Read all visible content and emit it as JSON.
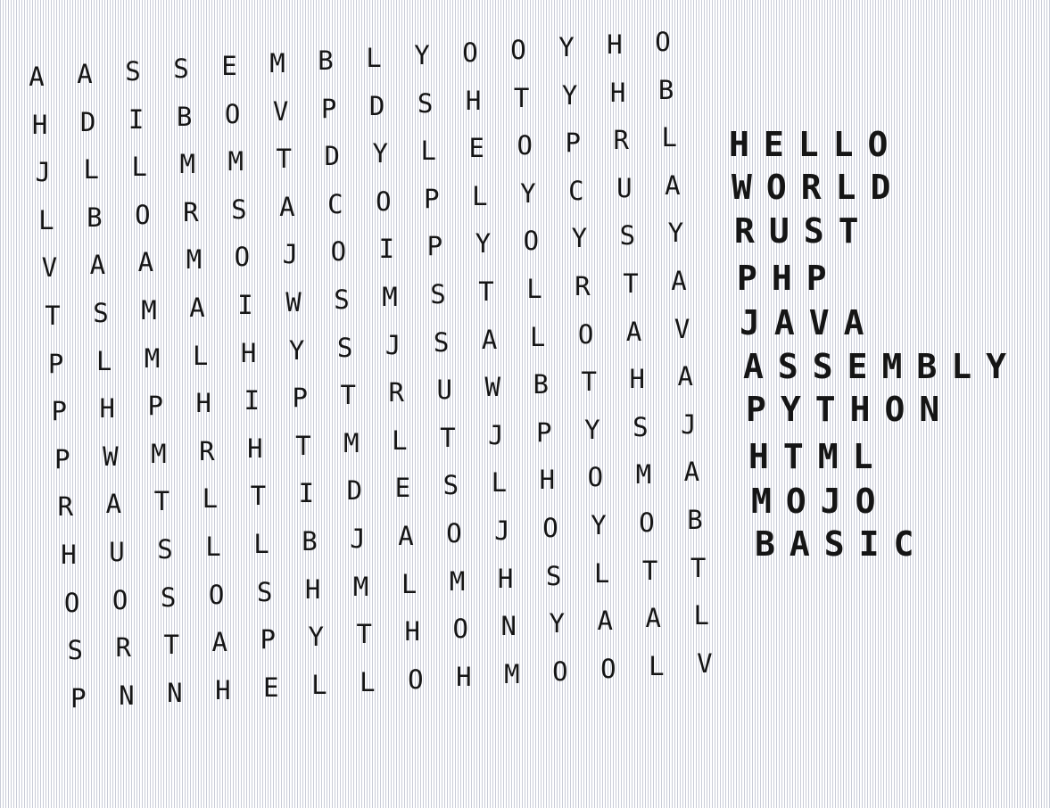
{
  "puzzle": {
    "grid": [
      "AASSEMBLYOOYHO",
      "HDIBOVPDSHTYHB",
      "JLLMMTDYLEOPRL",
      "LBORSACOPLYCUA",
      "VAAMOJOIPYOYSY",
      "TSMAIWSMSTLRTA",
      "PLMLHYSJSALOAV",
      "PHPHIPTRUWBTHA",
      "PWMRHTMLTJPYSJ",
      "RATLTIDESLHOMA",
      "HUSLLBJAOJOYOB",
      "OOSOSHMLMHSLTT",
      "SRTAPYTHONYAAL",
      "PNNHELLOHMOOLV"
    ]
  },
  "word_list": {
    "words": [
      "HELLO",
      "WORLD",
      "RUST",
      "PHP",
      "JAVA",
      "ASSEMBLY",
      "PYTHON",
      "HTML",
      "MOJO",
      "BASIC"
    ]
  }
}
